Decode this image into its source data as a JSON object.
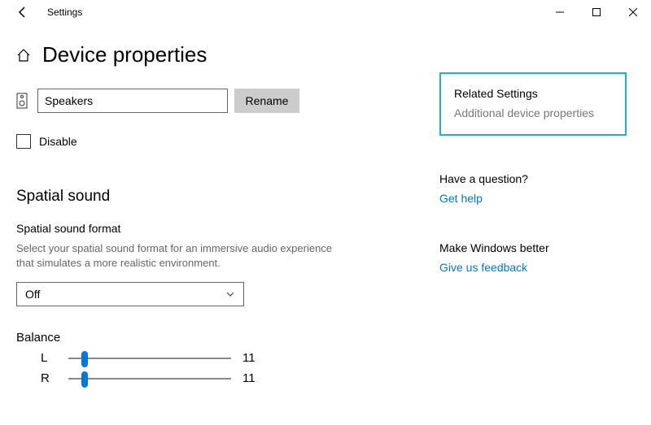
{
  "titlebar": {
    "title": "Settings"
  },
  "page": {
    "title": "Device properties"
  },
  "device": {
    "name": "Speakers",
    "rename_label": "Rename"
  },
  "disable": {
    "label": "Disable"
  },
  "spatial": {
    "heading": "Spatial sound",
    "format_label": "Spatial sound format",
    "description": "Select your spatial sound format for an immersive audio experience that simulates a more realistic environment.",
    "selected": "Off"
  },
  "balance": {
    "heading": "Balance",
    "left_label": "L",
    "left_value": "11",
    "right_label": "R",
    "right_value": "11"
  },
  "sidebar": {
    "related_heading": "Related Settings",
    "related_link": "Additional device properties",
    "question_heading": "Have a question?",
    "question_link": "Get help",
    "better_heading": "Make Windows better",
    "better_link": "Give us feedback"
  }
}
